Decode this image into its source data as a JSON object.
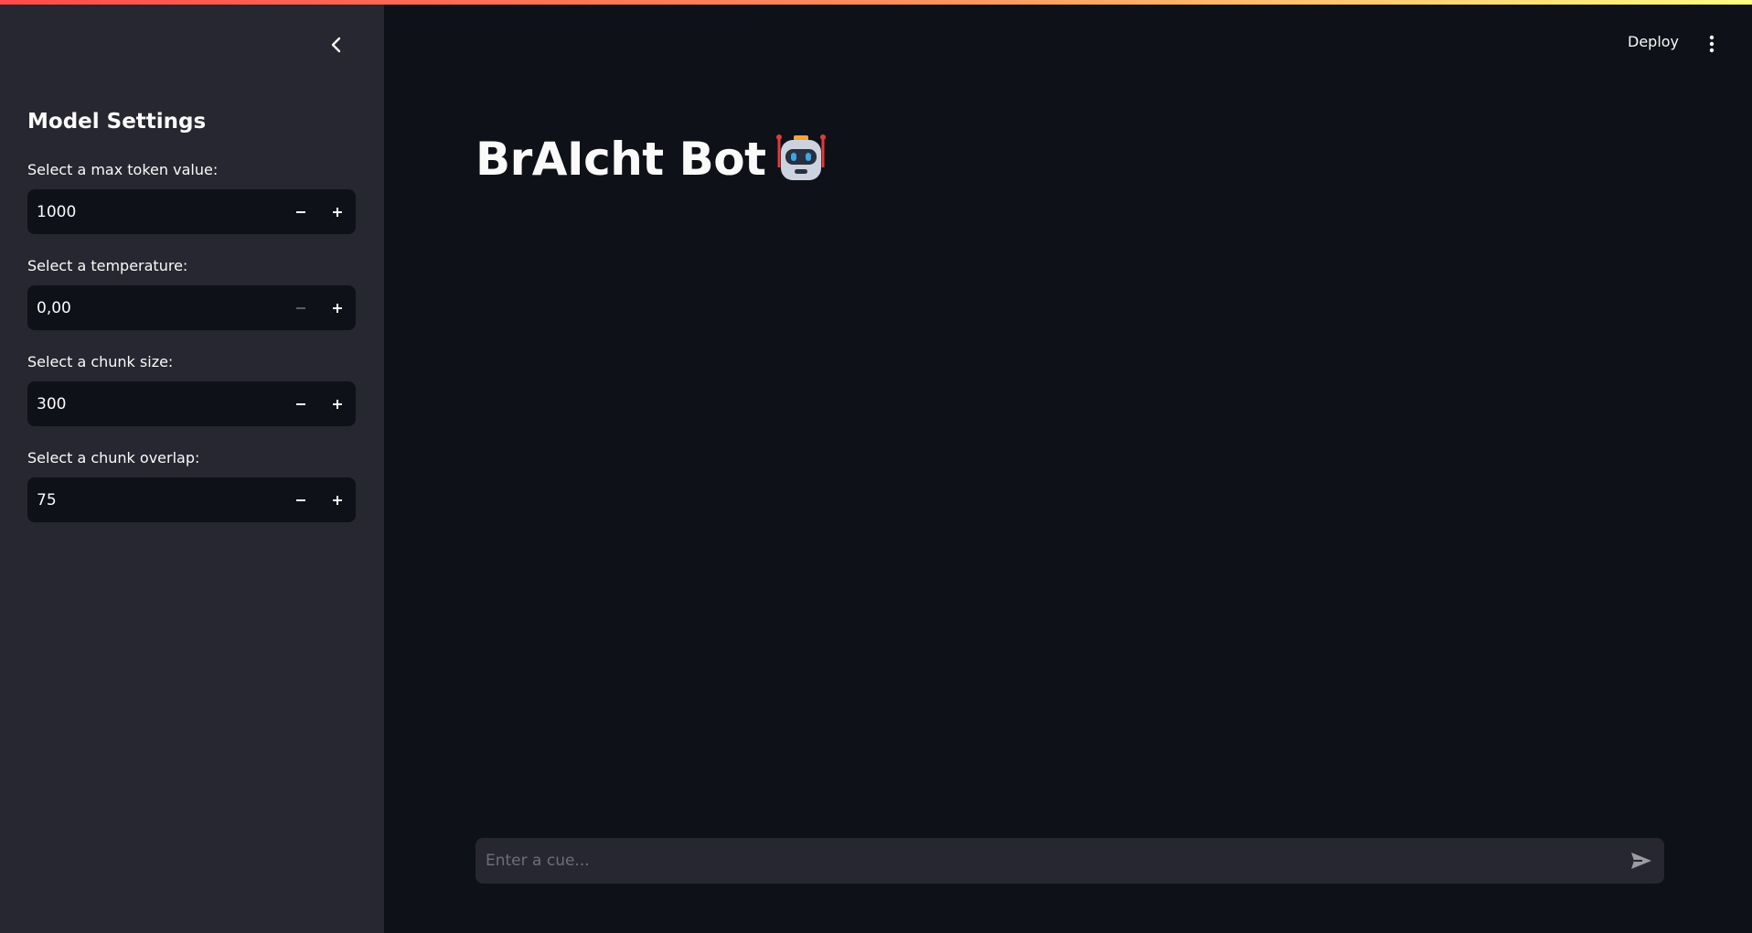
{
  "sidebar": {
    "title": "Model Settings",
    "fields": [
      {
        "label": "Select a max token value:",
        "value": "1000"
      },
      {
        "label": "Select a temperature:",
        "value": "0,00"
      },
      {
        "label": "Select a chunk size:",
        "value": "300"
      },
      {
        "label": "Select a chunk overlap:",
        "value": "75"
      }
    ]
  },
  "header": {
    "deploy_label": "Deploy"
  },
  "main": {
    "title": "BrAIcht Bot"
  },
  "chat": {
    "placeholder": "Enter a cue..."
  },
  "colors": {
    "sidebar_bg": "#262730",
    "main_bg": "#0e1117",
    "accent": "#ff4b4b"
  }
}
